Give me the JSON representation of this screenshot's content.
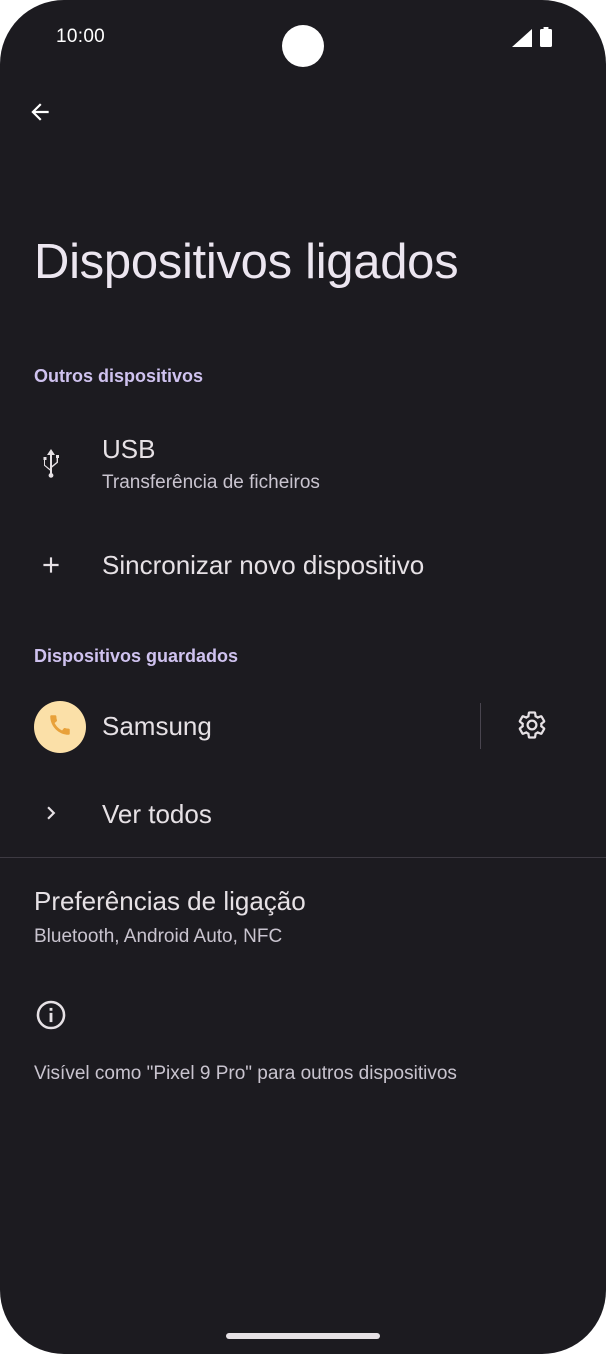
{
  "status_bar": {
    "time": "10:00",
    "icons": [
      "signal-icon",
      "battery-icon"
    ]
  },
  "header": {
    "back_icon": "arrow-back-icon",
    "title": "Dispositivos ligados"
  },
  "sections": {
    "other_devices": {
      "header": "Outros dispositivos",
      "usb": {
        "icon": "usb-icon",
        "title": "USB",
        "subtitle": "Transferência de ficheiros"
      },
      "pair_new": {
        "icon": "plus-icon",
        "title": "Sincronizar novo dispositivo"
      }
    },
    "saved_devices": {
      "header": "Dispositivos guardados",
      "device": {
        "icon": "phone-icon",
        "name": "Samsung",
        "settings_icon": "gear-icon"
      },
      "see_all": {
        "icon": "chevron-right-icon",
        "title": "Ver todos"
      }
    }
  },
  "connection_preferences": {
    "title": "Preferências de ligação",
    "subtitle": "Bluetooth, Android Auto, NFC"
  },
  "footer": {
    "icon": "info-icon",
    "text": "Visível como \"Pixel 9 Pro\" para outros dispositivos"
  },
  "colors": {
    "background": "#1c1b20",
    "accent_header": "#cfc2ef",
    "avatar_bg": "#fbe0a8",
    "avatar_icon": "#e8a13a"
  }
}
